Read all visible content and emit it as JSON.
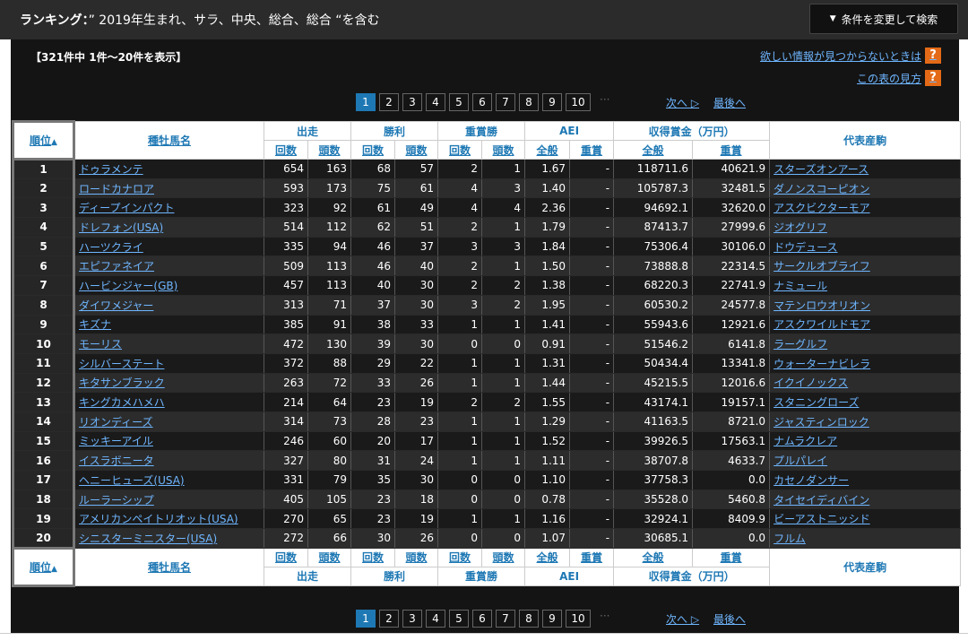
{
  "header": {
    "title_prefix": "ランキング：",
    "title_query": "” 2019年生まれ、サラ、中央、総合、総合 “を含む",
    "change_button": "条件を変更して検索",
    "change_button_icon": "triangle-down-icon"
  },
  "info": {
    "count_text": "【321件中 1件～20件を表示】",
    "help_link": "欲しい情報が見つからないときは",
    "howto_link": "この表の見方",
    "help_icon": "?"
  },
  "pager": {
    "pages": [
      "1",
      "2",
      "3",
      "4",
      "5",
      "6",
      "7",
      "8",
      "9",
      "10"
    ],
    "active": "1",
    "dots": "···",
    "next": "次へ ▷",
    "last": "最後へ"
  },
  "table": {
    "head": {
      "rank": "順位",
      "sort_mark": "▲",
      "sire": "種牡馬名",
      "starts": "出走",
      "wins": "勝利",
      "graded": "重賞勝",
      "aei": "AEI",
      "prize": "収得賞金（万円）",
      "rep": "代表産駒",
      "kaisu": "回数",
      "tosu": "頭数",
      "all": "全般",
      "jusho": "重賞"
    },
    "rows": [
      [
        "1",
        "ドゥラメンテ",
        "654",
        "163",
        "68",
        "57",
        "2",
        "1",
        "1.67",
        "-",
        "118711.6",
        "40621.9",
        "スターズオンアース"
      ],
      [
        "2",
        "ロードカナロア",
        "593",
        "173",
        "75",
        "61",
        "4",
        "3",
        "1.40",
        "-",
        "105787.3",
        "32481.5",
        "ダノンスコーピオン"
      ],
      [
        "3",
        "ディープインパクト",
        "323",
        "92",
        "61",
        "49",
        "4",
        "4",
        "2.36",
        "-",
        "94692.1",
        "32620.0",
        "アスクビクターモア"
      ],
      [
        "4",
        "ドレフォン(USA)",
        "514",
        "112",
        "62",
        "51",
        "2",
        "1",
        "1.79",
        "-",
        "87413.7",
        "27999.6",
        "ジオグリフ"
      ],
      [
        "5",
        "ハーツクライ",
        "335",
        "94",
        "46",
        "37",
        "3",
        "3",
        "1.84",
        "-",
        "75306.4",
        "30106.0",
        "ドウデュース"
      ],
      [
        "6",
        "エピファネイア",
        "509",
        "113",
        "46",
        "40",
        "2",
        "1",
        "1.50",
        "-",
        "73888.8",
        "22314.5",
        "サークルオブライフ"
      ],
      [
        "7",
        "ハービンジャー(GB)",
        "457",
        "113",
        "40",
        "30",
        "2",
        "2",
        "1.38",
        "-",
        "68220.3",
        "22741.9",
        "ナミュール"
      ],
      [
        "8",
        "ダイワメジャー",
        "313",
        "71",
        "37",
        "30",
        "3",
        "2",
        "1.95",
        "-",
        "60530.2",
        "24577.8",
        "マテンロウオリオン"
      ],
      [
        "9",
        "キズナ",
        "385",
        "91",
        "38",
        "33",
        "1",
        "1",
        "1.41",
        "-",
        "55943.6",
        "12921.6",
        "アスクワイルドモア"
      ],
      [
        "10",
        "モーリス",
        "472",
        "130",
        "39",
        "30",
        "0",
        "0",
        "0.91",
        "-",
        "51546.2",
        "6141.8",
        "ラーグルフ"
      ],
      [
        "11",
        "シルバーステート",
        "372",
        "88",
        "29",
        "22",
        "1",
        "1",
        "1.31",
        "-",
        "50434.4",
        "13341.8",
        "ウォーターナビレラ"
      ],
      [
        "12",
        "キタサンブラック",
        "263",
        "72",
        "33",
        "26",
        "1",
        "1",
        "1.44",
        "-",
        "45215.5",
        "12016.6",
        "イクイノックス"
      ],
      [
        "13",
        "キングカメハメハ",
        "214",
        "64",
        "23",
        "19",
        "2",
        "2",
        "1.55",
        "-",
        "43174.1",
        "19157.1",
        "スタニングローズ"
      ],
      [
        "14",
        "リオンディーズ",
        "314",
        "73",
        "28",
        "23",
        "1",
        "1",
        "1.29",
        "-",
        "41163.5",
        "8721.0",
        "ジャスティンロック"
      ],
      [
        "15",
        "ミッキーアイル",
        "246",
        "60",
        "20",
        "17",
        "1",
        "1",
        "1.52",
        "-",
        "39926.5",
        "17563.1",
        "ナムラクレア"
      ],
      [
        "16",
        "イスラボニータ",
        "327",
        "80",
        "31",
        "24",
        "1",
        "1",
        "1.11",
        "-",
        "38707.8",
        "4633.7",
        "プルパレイ"
      ],
      [
        "17",
        "ヘニーヒューズ(USA)",
        "331",
        "79",
        "35",
        "30",
        "0",
        "0",
        "1.10",
        "-",
        "37758.3",
        "0.0",
        "カセノダンサー"
      ],
      [
        "18",
        "ルーラーシップ",
        "405",
        "105",
        "23",
        "18",
        "0",
        "0",
        "0.78",
        "-",
        "35528.0",
        "5460.8",
        "タイセイディバイン"
      ],
      [
        "19",
        "アメリカンペイトリオット(USA)",
        "270",
        "65",
        "23",
        "19",
        "1",
        "1",
        "1.16",
        "-",
        "32924.1",
        "8409.9",
        "ビーアストニッシド"
      ],
      [
        "20",
        "シニスターミニスター(USA)",
        "272",
        "66",
        "30",
        "26",
        "0",
        "0",
        "1.07",
        "-",
        "30685.1",
        "0.0",
        "フルム"
      ]
    ]
  },
  "colors": {
    "accent": "#1e78b4",
    "link": "#6fb6ff",
    "help": "#e46a17",
    "bg": "#141414"
  }
}
